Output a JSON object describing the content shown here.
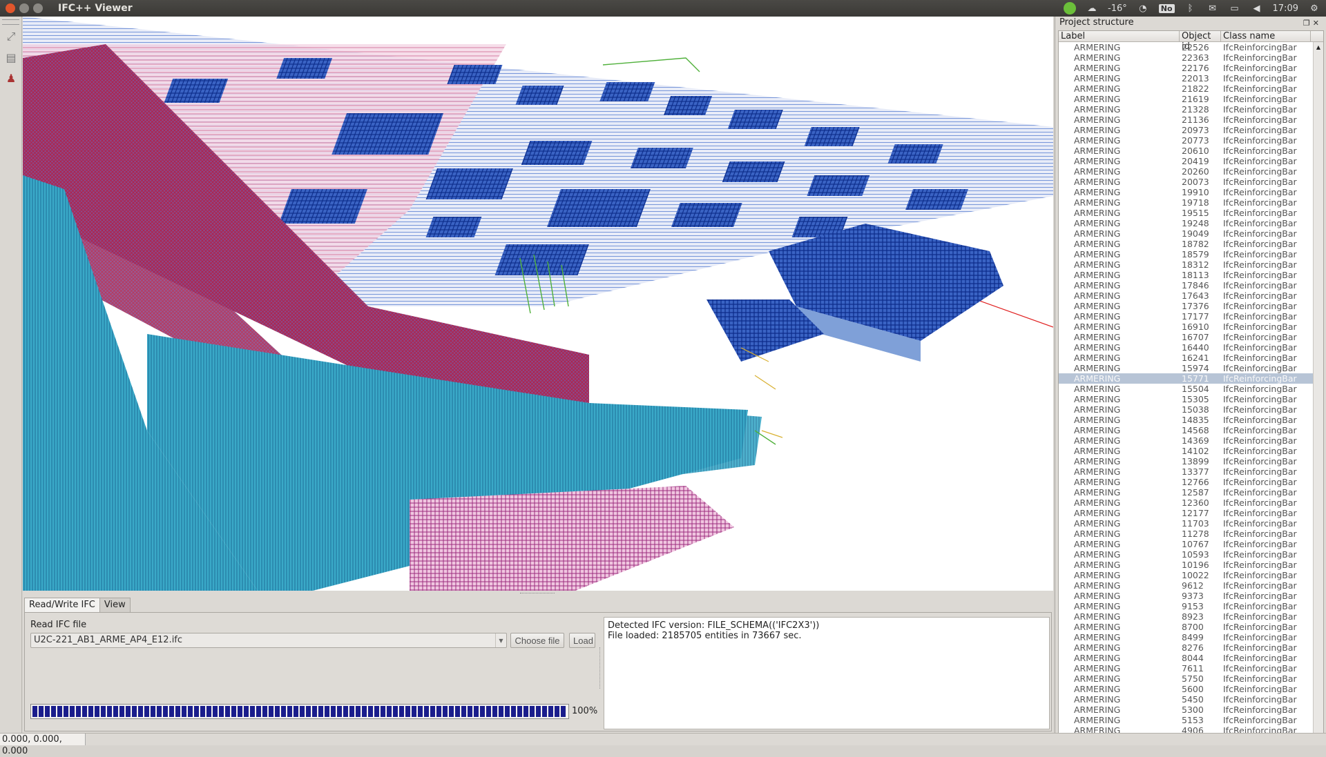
{
  "window": {
    "title": "IFC++ Viewer"
  },
  "tray": {
    "temperature": "-16°",
    "no_badge": "No",
    "time": "17:09"
  },
  "dock": {
    "title": "Project structure",
    "columns": {
      "label": "Label",
      "id": "Object id",
      "class": "Class name"
    },
    "selected_id": "15771",
    "rows": [
      {
        "label": "ARMERING",
        "id": "22526",
        "class": "IfcReinforcingBar"
      },
      {
        "label": "ARMERING",
        "id": "22363",
        "class": "IfcReinforcingBar"
      },
      {
        "label": "ARMERING",
        "id": "22176",
        "class": "IfcReinforcingBar"
      },
      {
        "label": "ARMERING",
        "id": "22013",
        "class": "IfcReinforcingBar"
      },
      {
        "label": "ARMERING",
        "id": "21822",
        "class": "IfcReinforcingBar"
      },
      {
        "label": "ARMERING",
        "id": "21619",
        "class": "IfcReinforcingBar"
      },
      {
        "label": "ARMERING",
        "id": "21328",
        "class": "IfcReinforcingBar"
      },
      {
        "label": "ARMERING",
        "id": "21136",
        "class": "IfcReinforcingBar"
      },
      {
        "label": "ARMERING",
        "id": "20973",
        "class": "IfcReinforcingBar"
      },
      {
        "label": "ARMERING",
        "id": "20773",
        "class": "IfcReinforcingBar"
      },
      {
        "label": "ARMERING",
        "id": "20610",
        "class": "IfcReinforcingBar"
      },
      {
        "label": "ARMERING",
        "id": "20419",
        "class": "IfcReinforcingBar"
      },
      {
        "label": "ARMERING",
        "id": "20260",
        "class": "IfcReinforcingBar"
      },
      {
        "label": "ARMERING",
        "id": "20073",
        "class": "IfcReinforcingBar"
      },
      {
        "label": "ARMERING",
        "id": "19910",
        "class": "IfcReinforcingBar"
      },
      {
        "label": "ARMERING",
        "id": "19718",
        "class": "IfcReinforcingBar"
      },
      {
        "label": "ARMERING",
        "id": "19515",
        "class": "IfcReinforcingBar"
      },
      {
        "label": "ARMERING",
        "id": "19248",
        "class": "IfcReinforcingBar"
      },
      {
        "label": "ARMERING",
        "id": "19049",
        "class": "IfcReinforcingBar"
      },
      {
        "label": "ARMERING",
        "id": "18782",
        "class": "IfcReinforcingBar"
      },
      {
        "label": "ARMERING",
        "id": "18579",
        "class": "IfcReinforcingBar"
      },
      {
        "label": "ARMERING",
        "id": "18312",
        "class": "IfcReinforcingBar"
      },
      {
        "label": "ARMERING",
        "id": "18113",
        "class": "IfcReinforcingBar"
      },
      {
        "label": "ARMERING",
        "id": "17846",
        "class": "IfcReinforcingBar"
      },
      {
        "label": "ARMERING",
        "id": "17643",
        "class": "IfcReinforcingBar"
      },
      {
        "label": "ARMERING",
        "id": "17376",
        "class": "IfcReinforcingBar"
      },
      {
        "label": "ARMERING",
        "id": "17177",
        "class": "IfcReinforcingBar"
      },
      {
        "label": "ARMERING",
        "id": "16910",
        "class": "IfcReinforcingBar"
      },
      {
        "label": "ARMERING",
        "id": "16707",
        "class": "IfcReinforcingBar"
      },
      {
        "label": "ARMERING",
        "id": "16440",
        "class": "IfcReinforcingBar"
      },
      {
        "label": "ARMERING",
        "id": "16241",
        "class": "IfcReinforcingBar"
      },
      {
        "label": "ARMERING",
        "id": "15974",
        "class": "IfcReinforcingBar"
      },
      {
        "label": "ARMERING",
        "id": "15771",
        "class": "IfcReinforcingBar"
      },
      {
        "label": "ARMERING",
        "id": "15504",
        "class": "IfcReinforcingBar"
      },
      {
        "label": "ARMERING",
        "id": "15305",
        "class": "IfcReinforcingBar"
      },
      {
        "label": "ARMERING",
        "id": "15038",
        "class": "IfcReinforcingBar"
      },
      {
        "label": "ARMERING",
        "id": "14835",
        "class": "IfcReinforcingBar"
      },
      {
        "label": "ARMERING",
        "id": "14568",
        "class": "IfcReinforcingBar"
      },
      {
        "label": "ARMERING",
        "id": "14369",
        "class": "IfcReinforcingBar"
      },
      {
        "label": "ARMERING",
        "id": "14102",
        "class": "IfcReinforcingBar"
      },
      {
        "label": "ARMERING",
        "id": "13899",
        "class": "IfcReinforcingBar"
      },
      {
        "label": "ARMERING",
        "id": "13377",
        "class": "IfcReinforcingBar"
      },
      {
        "label": "ARMERING",
        "id": "12766",
        "class": "IfcReinforcingBar"
      },
      {
        "label": "ARMERING",
        "id": "12587",
        "class": "IfcReinforcingBar"
      },
      {
        "label": "ARMERING",
        "id": "12360",
        "class": "IfcReinforcingBar"
      },
      {
        "label": "ARMERING",
        "id": "12177",
        "class": "IfcReinforcingBar"
      },
      {
        "label": "ARMERING",
        "id": "11703",
        "class": "IfcReinforcingBar"
      },
      {
        "label": "ARMERING",
        "id": "11278",
        "class": "IfcReinforcingBar"
      },
      {
        "label": "ARMERING",
        "id": "10767",
        "class": "IfcReinforcingBar"
      },
      {
        "label": "ARMERING",
        "id": "10593",
        "class": "IfcReinforcingBar"
      },
      {
        "label": "ARMERING",
        "id": "10196",
        "class": "IfcReinforcingBar"
      },
      {
        "label": "ARMERING",
        "id": "10022",
        "class": "IfcReinforcingBar"
      },
      {
        "label": "ARMERING",
        "id": "9612",
        "class": "IfcReinforcingBar"
      },
      {
        "label": "ARMERING",
        "id": "9373",
        "class": "IfcReinforcingBar"
      },
      {
        "label": "ARMERING",
        "id": "9153",
        "class": "IfcReinforcingBar"
      },
      {
        "label": "ARMERING",
        "id": "8923",
        "class": "IfcReinforcingBar"
      },
      {
        "label": "ARMERING",
        "id": "8700",
        "class": "IfcReinforcingBar"
      },
      {
        "label": "ARMERING",
        "id": "8499",
        "class": "IfcReinforcingBar"
      },
      {
        "label": "ARMERING",
        "id": "8276",
        "class": "IfcReinforcingBar"
      },
      {
        "label": "ARMERING",
        "id": "8044",
        "class": "IfcReinforcingBar"
      },
      {
        "label": "ARMERING",
        "id": "7611",
        "class": "IfcReinforcingBar"
      },
      {
        "label": "ARMERING",
        "id": "5750",
        "class": "IfcReinforcingBar"
      },
      {
        "label": "ARMERING",
        "id": "5600",
        "class": "IfcReinforcingBar"
      },
      {
        "label": "ARMERING",
        "id": "5450",
        "class": "IfcReinforcingBar"
      },
      {
        "label": "ARMERING",
        "id": "5300",
        "class": "IfcReinforcingBar"
      },
      {
        "label": "ARMERING",
        "id": "5153",
        "class": "IfcReinforcingBar"
      },
      {
        "label": "ARMERING",
        "id": "4906",
        "class": "IfcReinforcingBar"
      }
    ]
  },
  "bottom": {
    "tabs": [
      {
        "label": "Read/Write IFC"
      },
      {
        "label": "View"
      }
    ],
    "read_label": "Read IFC file",
    "file_value": "U2C-221_AB1_ARME_AP4_E12.ifc",
    "choose_label": "Choose file",
    "load_label": "Load",
    "log_lines": [
      "Detected IFC version: FILE_SCHEMA(('IFC2X3'))",
      "File loaded: 2185705 entities in 73667 sec."
    ],
    "progress_percent": 100,
    "progress_text": "100%"
  },
  "status": {
    "coords": "0.000, 0.000, 0.000"
  },
  "colors": {
    "accent_selected": "#b7c4d6",
    "progress": "#1a1d8c",
    "rebar_blue": "#1f4bb5",
    "rebar_red": "#b0224a",
    "rebar_cyan": "#2aa6c8"
  },
  "icons": [
    "close-icon",
    "minimize-icon",
    "maximize-icon",
    "spotify-icon",
    "weather-icon",
    "wifi-icon",
    "bluetooth-icon",
    "mail-icon",
    "battery-icon",
    "volume-icon",
    "gear-icon",
    "zoom-fit-icon",
    "view-cube-icon",
    "walk-icon"
  ]
}
